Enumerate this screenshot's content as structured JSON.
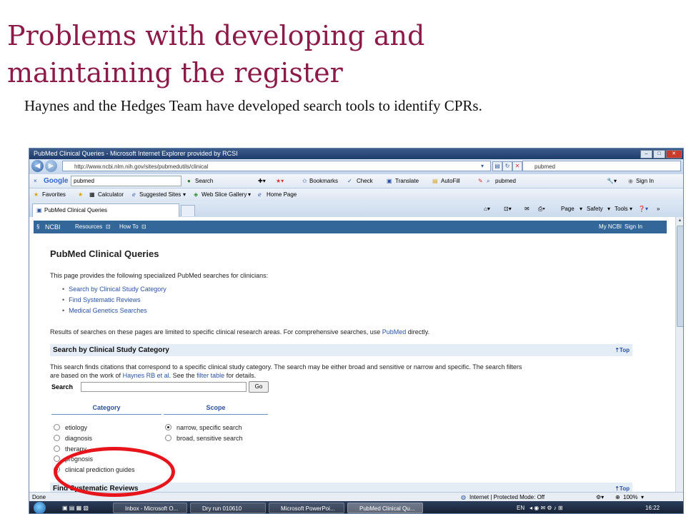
{
  "slide": {
    "title_line1": "Problems with developing and",
    "title_line2": "maintaining the register",
    "body": "Haynes and the Hedges Team have developed search tools to identify CPRs."
  },
  "browser": {
    "window_title": "PubMed Clinical Queries - Microsoft Internet Explorer provided by RCSI",
    "url": "http://www.ncbi.nlm.nih.gov/sites/pubmedutils/clinical",
    "search_box": "pubmed",
    "google_toolbar": {
      "brand": "Google",
      "query": "pubmed",
      "search": "Search",
      "bookmarks": "Bookmarks",
      "check": "Check",
      "translate": "Translate",
      "autofill": "AutoFill",
      "pubmed_link": "pubmed",
      "sign_in": "Sign In"
    },
    "favorites_bar": {
      "favorites": "Favorites",
      "calculator": "Calculator",
      "suggested": "Suggested Sites",
      "webslice": "Web Slice Gallery",
      "home": "Home Page"
    },
    "tab_label": "PubMed Clinical Queries",
    "command_bar": {
      "page": "Page",
      "safety": "Safety",
      "tools": "Tools"
    },
    "status": {
      "left": "Done",
      "zone": "Internet | Protected Mode: Off",
      "zoom": "100%"
    }
  },
  "ncbi": {
    "logo": "NCBI",
    "resources": "Resources",
    "howto": "How To",
    "mync": "My NCBI",
    "signin": "Sign In"
  },
  "page": {
    "heading": "PubMed Clinical Queries",
    "intro": "This page provides the following specialized PubMed searches for clinicians:",
    "links": [
      "Search by Clinical Study Category",
      "Find Systematic Reviews",
      "Medical Genetics Searches"
    ],
    "limit_text_pre": "Results of searches on these pages are limited to specific clinical research areas. For comprehensive searches, use",
    "limit_link": "PubMed",
    "limit_text_post": "directly.",
    "section1": "Search by Clinical Study Category",
    "top_label": "Top",
    "desc_line1": "This search finds citations that correspond to a specific clinical study category. The search may be either broad and sensitive or narrow and specific. The search filters",
    "desc_line2_pre": "are based on the work of",
    "haynes_link": "Haynes RB et al",
    "desc_line2_mid": ". See the",
    "filter_link": "filter table",
    "desc_line2_post": "for details.",
    "search_label": "Search",
    "go_label": "Go",
    "category_head": "Category",
    "scope_head": "Scope",
    "categories": [
      "etiology",
      "diagnosis",
      "therapy",
      "prognosis",
      "clinical prediction guides"
    ],
    "scopes": [
      "narrow, specific search",
      "broad, sensitive search"
    ],
    "section2": "Find Systematic Reviews"
  },
  "taskbar": {
    "items": [
      "Inbox - Microsoft O...",
      "Dry run 010610",
      "Microsoft PowerPoi...",
      "PubMed Clinical Qu..."
    ],
    "lang": "EN",
    "clock": "16:22"
  },
  "colors": {
    "title": "#8d1b4a",
    "ncbi_bar": "#336699",
    "link": "#2a52a0",
    "annotation": "#e8141c"
  }
}
